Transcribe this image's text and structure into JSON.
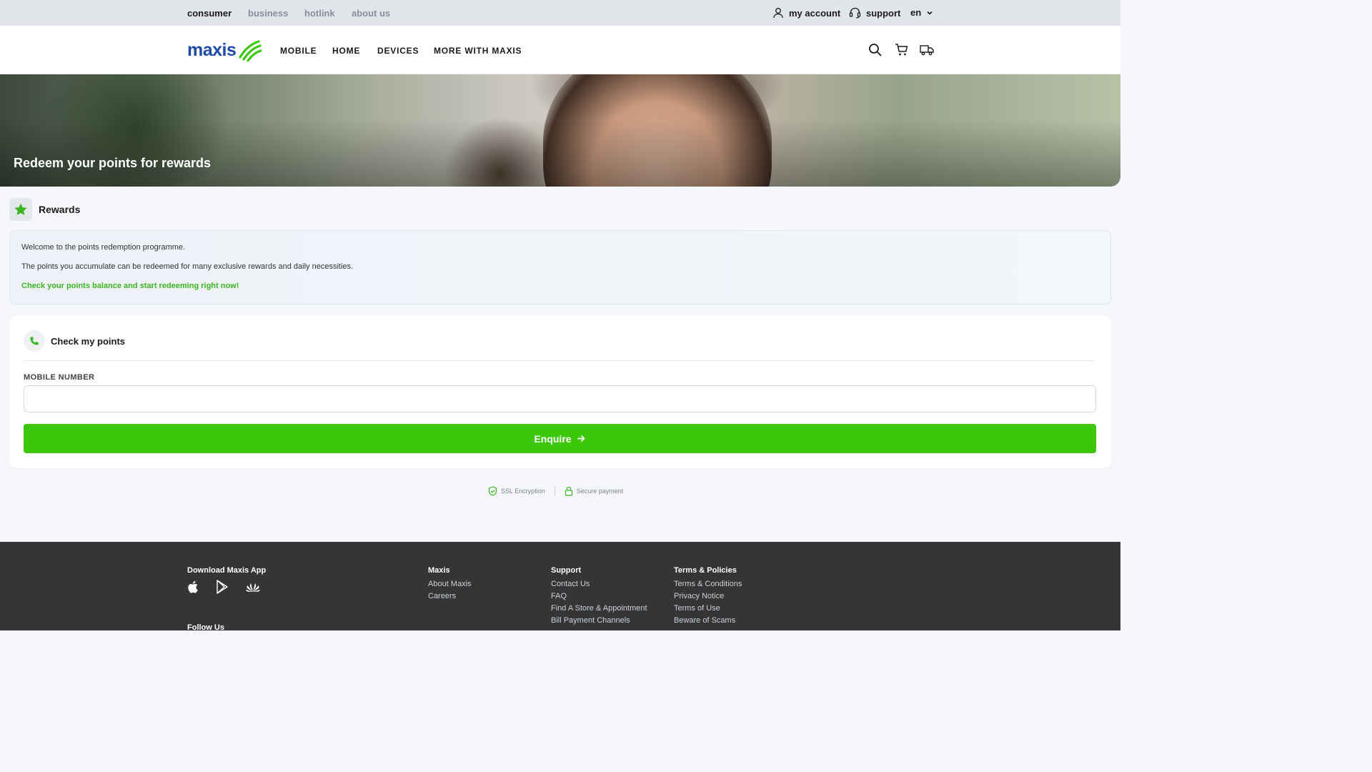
{
  "topbar": {
    "segments": [
      "consumer",
      "business",
      "hotlink",
      "about us"
    ],
    "active_segment": "consumer",
    "my_account": "my account",
    "support": "support",
    "language": "en"
  },
  "nav": {
    "logo": "maxis",
    "links": [
      "MOBILE",
      "HOME",
      "DEVICES",
      "MORE WITH MAXIS"
    ]
  },
  "hero": {
    "title": "Redeem your points for rewards"
  },
  "rewards": {
    "label": "Rewards"
  },
  "info": {
    "line1": "Welcome to the points redemption programme.",
    "line2": "The points you accumulate can be redeemed for many exclusive rewards and daily necessities.",
    "cta": "Check your points balance and start redeeming right now!"
  },
  "check": {
    "title": "Check my points",
    "field_label": "MOBILE NUMBER",
    "field_value": "",
    "field_placeholder": "",
    "button": "Enquire"
  },
  "security": {
    "ssl": "SSL Encryption",
    "payment": "Secure payment"
  },
  "footer": {
    "download_title": "Download Maxis App",
    "follow_title": "Follow Us",
    "columns": [
      {
        "title": "Maxis",
        "links": [
          "About Maxis",
          "Careers"
        ]
      },
      {
        "title": "Support",
        "links": [
          "Contact Us",
          "FAQ",
          "Find A Store & Appointment",
          "Bill Payment Channels"
        ]
      },
      {
        "title": "Terms & Policies",
        "links": [
          "Terms & Conditions",
          "Privacy Notice",
          "Terms of Use",
          "Beware of Scams"
        ]
      }
    ]
  },
  "colors": {
    "brand_green": "#3cc809",
    "brand_blue": "#1f4aa8",
    "footer_bg": "#333537"
  }
}
